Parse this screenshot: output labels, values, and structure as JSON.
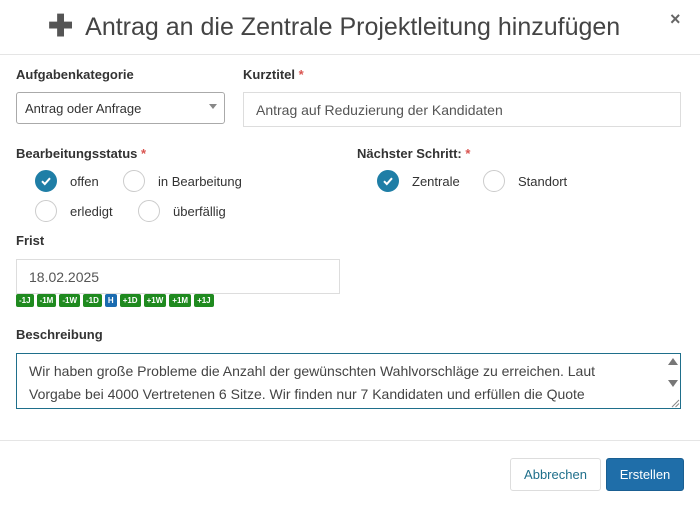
{
  "dialog": {
    "title": "Antrag an die Zentrale Projektleitung hinzufügen",
    "plus_symbol": "✚",
    "close_symbol": "×"
  },
  "category": {
    "label": "Aufgabenkategorie",
    "selected": "Antrag oder Anfrage"
  },
  "short_title": {
    "label": "Kurztitel",
    "required": "*",
    "value": "Antrag auf Reduzierung der Kandidaten"
  },
  "status": {
    "label": "Bearbeitungsstatus",
    "required": "*",
    "options": [
      {
        "label": "offen",
        "checked": true
      },
      {
        "label": "in Bearbeitung",
        "checked": false
      },
      {
        "label": "erledigt",
        "checked": false
      },
      {
        "label": "überfällig",
        "checked": false
      }
    ]
  },
  "next_step": {
    "label": "Nächster Schritt:",
    "required": "*",
    "options": [
      {
        "label": "Zentrale",
        "checked": true
      },
      {
        "label": "Standort",
        "checked": false
      }
    ]
  },
  "deadline": {
    "label": "Frist",
    "value": "18.02.2025",
    "shortcuts": [
      "-1J",
      "-1M",
      "-1W",
      "-1D",
      "H",
      "+1D",
      "+1W",
      "+1M",
      "+1J"
    ]
  },
  "description": {
    "label": "Beschreibung",
    "line1": "Wir haben große Probleme die Anzahl der gewünschten Wahlvorschläge zu erreichen. Laut",
    "line2": "Vorgabe bei 4000 Vertretenen 6 Sitze. Wir finden nur 7 Kandidaten und erfüllen die Quote"
  },
  "footer": {
    "cancel_label": "Abbrechen",
    "create_label": "Erstellen"
  },
  "colors": {
    "accent": "#1f7ea6",
    "primary_button": "#1f6ea9",
    "badge_green": "#1f8a1f",
    "badge_blue": "#1a6bb0",
    "required": "#d9534f"
  }
}
